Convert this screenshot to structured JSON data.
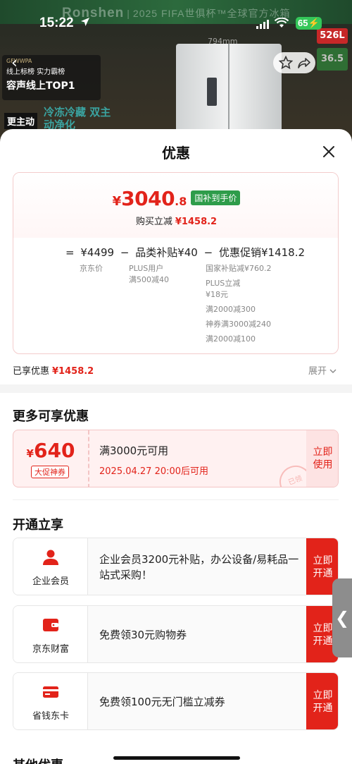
{
  "status_bar": {
    "time": "15:22",
    "battery": "65"
  },
  "background": {
    "brand": "Ronshen",
    "brand_sub": "2025 FIFA世俱杯™全球官方冰箱",
    "promo_line1": "GFWWPA",
    "promo_line2": "线上标榜 实力霸榜",
    "promo_line3": "容声线上TOP1",
    "left_badge": "更主动",
    "freeze_text": "冷冻冷藏 双主动净化",
    "dimension": "794mm",
    "tag_capacity": "526L",
    "tag_green": "36.5"
  },
  "sheet": {
    "title": "优惠",
    "summary": {
      "currency": "¥",
      "price_main": "3040",
      "price_decimal": ".8",
      "gov_badge": "国补到手价",
      "cut_label": "购买立减",
      "cut_amount": "¥1458.2",
      "formula": {
        "eq": "=",
        "base": "¥4499",
        "minus1": "−",
        "subsidy": "品类补贴¥40",
        "minus2": "−",
        "promo": "优惠促销¥1418.2"
      },
      "base_notes": [
        "京东价"
      ],
      "subsidy_notes": [
        "PLUS用户",
        "满500减40"
      ],
      "promo_notes": [
        "国家补贴减¥760.2",
        "PLUS立减",
        "¥18元",
        "满2000减300",
        "神券满3000减240",
        "满2000减100"
      ]
    },
    "enjoyed": {
      "label": "已享优惠",
      "amount": "¥1458.2"
    },
    "expand": {
      "label": "展开"
    },
    "more_section": {
      "title": "更多可享优惠",
      "coupon": {
        "currency": "¥",
        "value": "640",
        "badge": "大促神券",
        "condition": "满3000元可用",
        "time": "2025.04.27 20:00后可用",
        "action_line1": "立即",
        "action_line2": "使用",
        "stamp": "已领"
      }
    },
    "open_section": {
      "title": "开通立享",
      "items": [
        {
          "name": "企业会员",
          "desc": "企业会员3200元补贴，办公设备/易耗品一站式采购！",
          "action_line1": "立即",
          "action_line2": "开通",
          "icon": "user-icon"
        },
        {
          "name": "京东财富",
          "desc": "免费领30元购物券",
          "action_line1": "立即",
          "action_line2": "开通",
          "icon": "wallet-icon"
        },
        {
          "name": "省钱东卡",
          "desc": "免费领100元无门槛立减券",
          "action_line1": "立即",
          "action_line2": "开通",
          "icon": "card-icon"
        }
      ]
    },
    "other_section": {
      "title": "其他优惠"
    },
    "side_tab": "❮"
  },
  "colors": {
    "accent_red": "#e2231a",
    "gov_green": "#2e9c4a",
    "battery_green": "#34c759"
  }
}
